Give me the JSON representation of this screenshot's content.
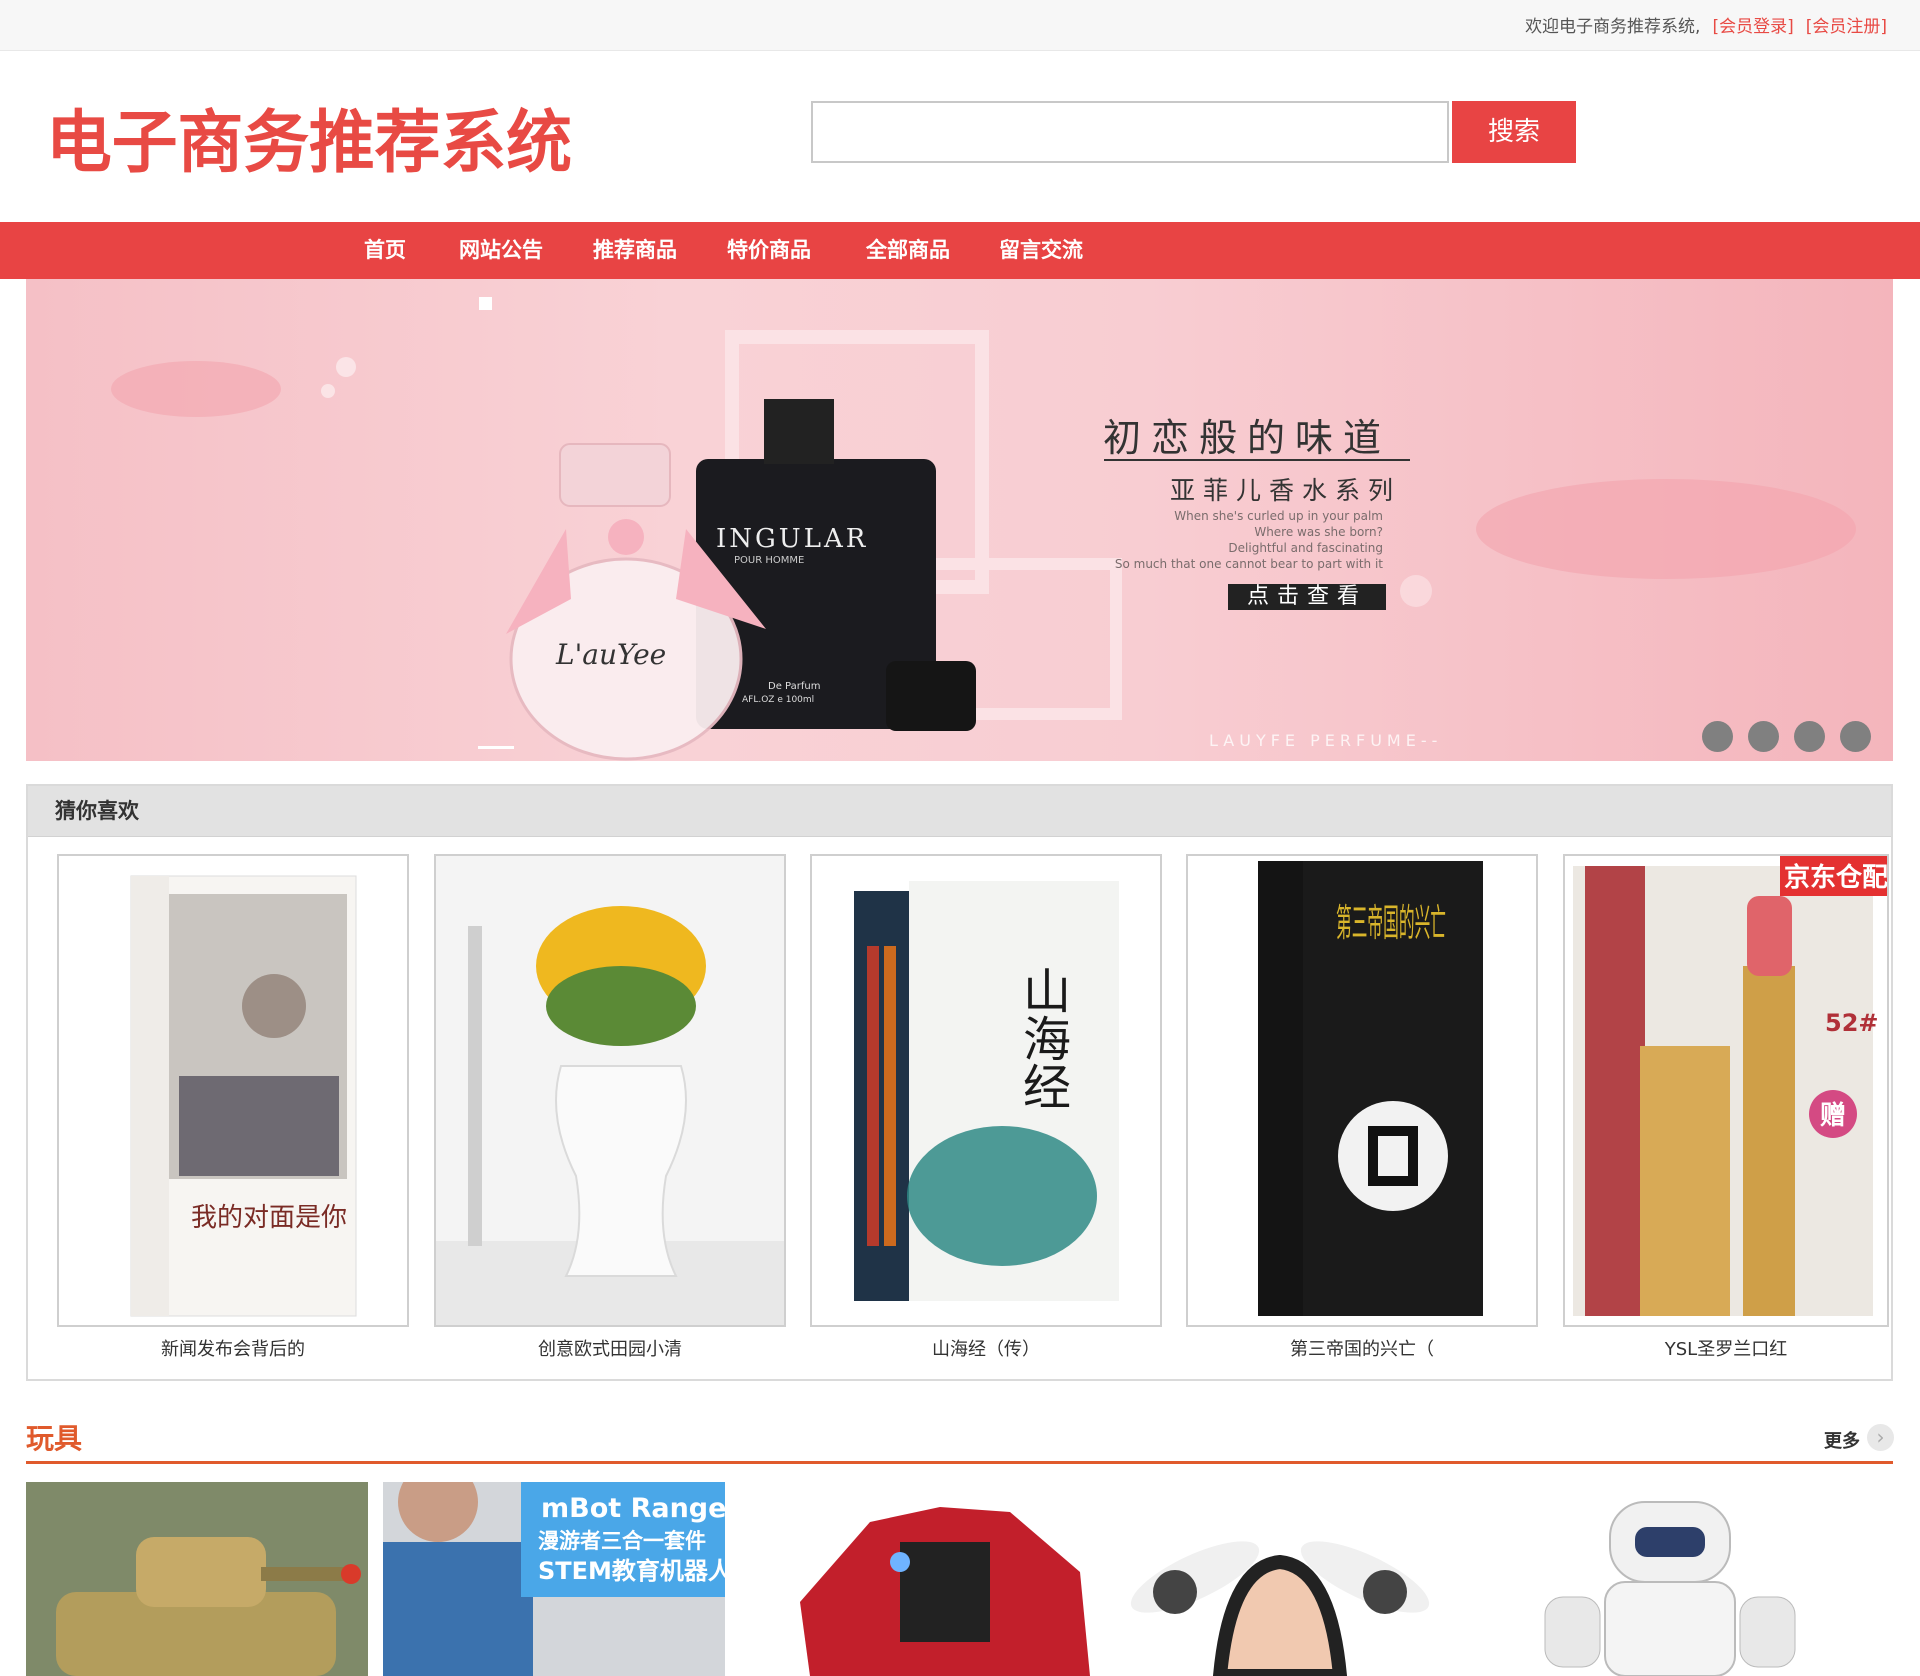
{
  "topbar": {
    "welcome": "欢迎电子商务推荐系统,",
    "login": "[会员登录]",
    "register": "[会员注册]"
  },
  "logo": {
    "text": "电子商务推荐系统"
  },
  "search": {
    "value": "",
    "placeholder": "",
    "button": "搜索"
  },
  "nav": [
    "首页",
    "网站公告",
    "推荐商品",
    "特价商品",
    "全部商品",
    "留言交流"
  ],
  "banner": {
    "headline": "初恋般的味道",
    "subheadline": "亚菲儿香水系列",
    "english": [
      "When she's curled up in your palm",
      "Where was she born?",
      "Delightful and fascinating",
      "So much that one cannot bear to part with it"
    ],
    "cta": "点击查看",
    "brand": "LAUYFE PERFUME--",
    "bottle_black": "INGULAR",
    "bottle_black_sub": "POUR HOMME",
    "bottle_black_bottom": "De Parfum",
    "bottle_black_bottom2": "AFL.OZ e 100ml",
    "bottle_pink": "L'auYee",
    "slide_count": 4
  },
  "guess": {
    "title": "猜你喜欢",
    "items": [
      {
        "name": "新闻发布会背后的",
        "book_title": "我的对面是你"
      },
      {
        "name": "创意欧式田园小清"
      },
      {
        "name": "山海经（传）",
        "book_title": "山海经"
      },
      {
        "name": "第三帝国的兴亡（",
        "book_title": "第三帝国的兴亡"
      },
      {
        "name": "YSL圣罗兰口红",
        "tag": "京东仓配",
        "shade": "52#",
        "gift": "赠"
      }
    ]
  },
  "toys": {
    "title": "玩具",
    "more": "更多",
    "items": [
      {
        "label": "tank"
      },
      {
        "label": "mBot Ranger",
        "sub1": "漫游者三合一套件",
        "sub2": "STEM教育机器人"
      },
      {
        "label": "robot car"
      },
      {
        "label": "drone"
      },
      {
        "label": "humanoid robot"
      }
    ]
  },
  "colors": {
    "accent": "#e84444",
    "toys": "#e05a2c"
  }
}
